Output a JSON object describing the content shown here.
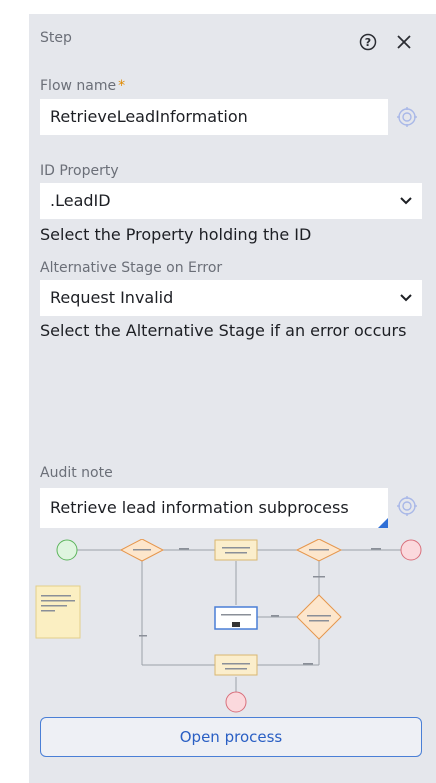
{
  "header": {
    "title": "Step"
  },
  "flow_name": {
    "label": "Flow name",
    "required_mark": "*",
    "value": "RetrieveLeadInformation"
  },
  "id_property": {
    "label": "ID Property",
    "value": ".LeadID",
    "help": "Select the Property holding the ID"
  },
  "alt_stage": {
    "label": "Alternative Stage on Error",
    "value": "Request Invalid",
    "help": "Select the Alternative Stage if an error occurs"
  },
  "audit_note": {
    "label": "Audit note",
    "value": "Retrieve lead information subprocess"
  },
  "actions": {
    "open_process": "Open process"
  },
  "colors": {
    "accent": "#2f6fd6",
    "required": "#e08a00",
    "panel_bg": "#e5e7ec"
  }
}
